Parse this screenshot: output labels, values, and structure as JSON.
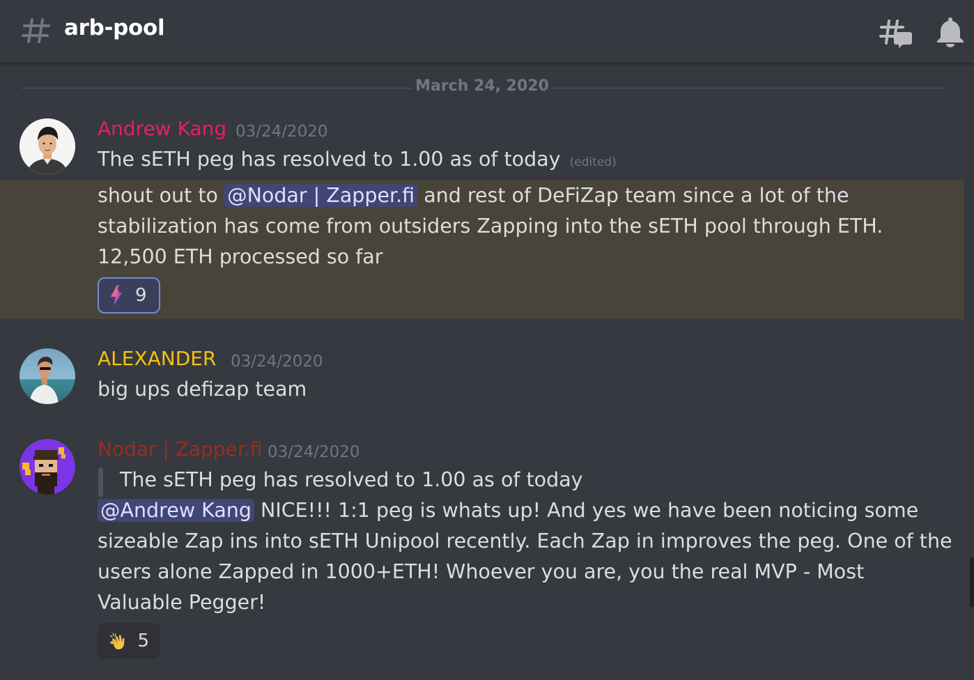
{
  "header": {
    "channel_name": "arb-pool",
    "hash_icon": "channel-hash-icon",
    "threads_icon": "threads-icon",
    "bell_icon": "notification-bell-icon"
  },
  "date_divider": "March 24, 2020",
  "messages": [
    {
      "author": "Andrew Kang",
      "author_color": "#e91e63",
      "timestamp": "03/24/2020",
      "lines": [
        {
          "text": "The sETH peg has resolved to 1.00 as of today",
          "edited": "(edited)"
        }
      ]
    },
    {
      "continuation": true,
      "mention": "@Nodar | Zapper.fi",
      "line1_prefix": "shout out to",
      "line1_suffix": "and rest of DeFiZap team since a lot of the",
      "line2": "stabilization has come from outsiders Zapping into the sETH pool through ETH.",
      "line3": "12,500 ETH processed so far",
      "reaction": {
        "emoji": "lightning-bolt",
        "count": "9",
        "active": true
      }
    },
    {
      "author": "ALEXANDER",
      "author_color": "#f1c40f",
      "timestamp": "03/24/2020",
      "lines": [
        {
          "text": "big ups defizap team"
        }
      ]
    },
    {
      "author": "Nodar | Zapper.fi",
      "author_color": "#992d22",
      "timestamp": "03/24/2020",
      "quote": "The sETH peg has resolved to 1.00 as of today",
      "mention": "@Andrew Kang",
      "line1_suffix": "NICE!!! 1:1 peg is whats up! And yes we have been noticing some",
      "line2": "sizeable Zap ins into sETH Unipool recently. Each Zap in improves the peg. One of the",
      "line3": "users alone Zapped in 1000+ETH! Whoever you are, you the real MVP - Most",
      "line4": "Valuable Pegger!",
      "reaction": {
        "emoji": "clapping-hands",
        "count": "5",
        "active": false
      }
    }
  ]
}
